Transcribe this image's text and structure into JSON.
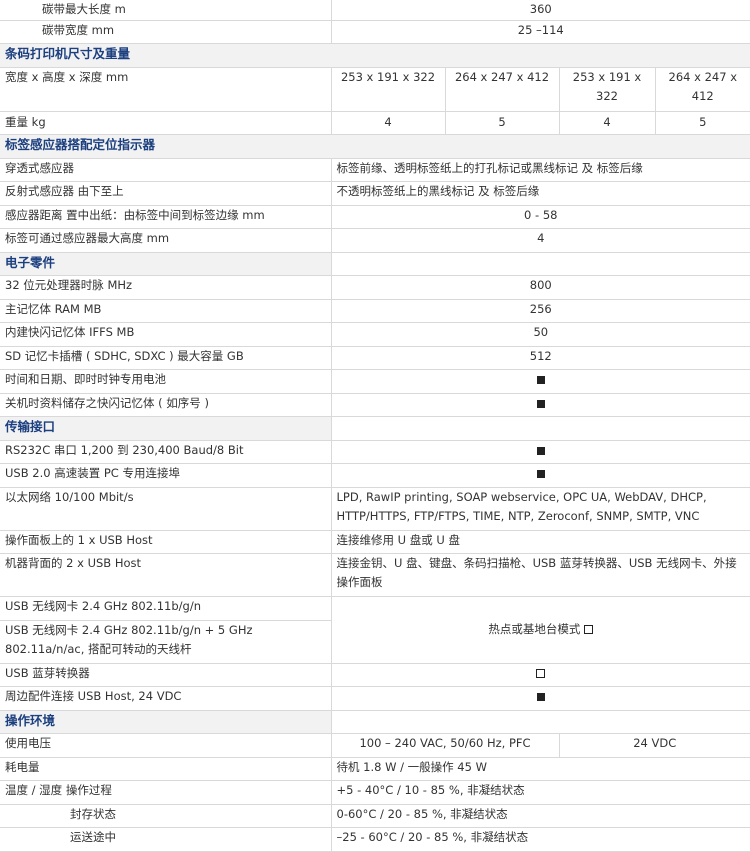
{
  "rows": {
    "ribbon_len": {
      "label": "碳带最大长度 m",
      "value": "360"
    },
    "ribbon_width": {
      "label": "碳带宽度 mm",
      "value": "25 –114"
    },
    "sec_dim": "条码打印机尺寸及重量",
    "dims": {
      "label": "宽度 x 高度 x 深度 mm",
      "v1": "253 x 191 x 322",
      "v2": "264 x 247 x 412",
      "v3": "253 x 191 x 322",
      "v4": "264 x 247 x 412"
    },
    "weight": {
      "label": "重量 kg",
      "v1": "4",
      "v2": "5",
      "v3": "4",
      "v4": "5"
    },
    "sec_sensor": "标签感应器搭配定位指示器",
    "trans": {
      "label": "穿透式感应器",
      "value": "标签前缘、透明标签纸上的打孔标记或黑线标记 及 标签后缘"
    },
    "refl": {
      "label": "反射式感应器 由下至上",
      "value": "不透明标签纸上的黑线标记 及 标签后缘"
    },
    "sdist": {
      "label": "感应器距离 置中出纸：由标签中间到标签边缘 mm",
      "value": "0 - 58"
    },
    "sheight": {
      "label": "标签可通过感应器最大高度 mm",
      "value": "4"
    },
    "sec_elec": "电子零件",
    "cpu": {
      "label": "32 位元处理器时脉 MHz",
      "value": "800"
    },
    "ram": {
      "label": "主记忆体 RAM MB",
      "value": "256"
    },
    "iffs": {
      "label": "内建快闪记忆体 IFFS MB",
      "value": "50"
    },
    "sd": {
      "label": "SD 记忆卡插槽 ( SDHC, SDXC ) 最大容量 GB",
      "value": "512"
    },
    "clock": {
      "label": "时间和日期、即时时钟专用电池"
    },
    "flash": {
      "label": "关机时资料储存之快闪记忆体 ( 如序号 )"
    },
    "sec_io": "传输接口",
    "rs232": {
      "label": "RS232C 串口 1,200 到 230,400 Baud/8 Bit"
    },
    "usb2": {
      "label": "USB 2.0 高速装置 PC 专用连接埠"
    },
    "eth": {
      "label": "以太网络 10/100 Mbit/s",
      "value": "LPD, RawIP printing, SOAP webservice, OPC UA, WebDAV, DHCP, HTTP/HTTPS, FTP/FTPS, TIME, NTP, Zeroconf, SNMP, SMTP, VNC"
    },
    "usbhost1": {
      "label": "操作面板上的 1 x USB Host",
      "value": "连接维修用 U 盘或 U 盘"
    },
    "usbhost2": {
      "label": "机器背面的 2 x USB Host",
      "value": "连接金钥、U 盘、键盘、条码扫描枪、USB 蓝芽转换器、USB 无线网卡、外接操作面板"
    },
    "wlan1": {
      "label": "USB 无线网卡 2.4 GHz 802.11b/g/n"
    },
    "wlan2": {
      "label": "USB 无线网卡 2.4 GHz 802.11b/g/n + 5 GHz 802.11a/n/ac, 搭配可转动的天线杆"
    },
    "wlan_value": "热点或基地台模式",
    "bt": {
      "label": "USB 蓝芽转换器"
    },
    "periph": {
      "label": "周边配件连接 USB Host, 24 VDC"
    },
    "sec_env": "操作环境",
    "voltage": {
      "label": "使用电压",
      "v1": "100 – 240 VAC, 50/60 Hz, PFC",
      "v2": "24 VDC"
    },
    "power": {
      "label": "耗电量",
      "value": "待机 1.8 W / 一般操作 45 W"
    },
    "temp": {
      "label": "温度 / 湿度 操作过程",
      "value": "+5 - 40°C / 10 - 85 %, 非凝结状态"
    },
    "storage": {
      "label": "封存状态",
      "value": "0-60°C / 20 - 85 %, 非凝结状态"
    },
    "transport": {
      "label": "运送途中",
      "value": "–25 - 60°C / 20 - 85 %, 非凝结状态"
    }
  },
  "icons": {
    "filled": "filled-square",
    "open": "open-square"
  }
}
